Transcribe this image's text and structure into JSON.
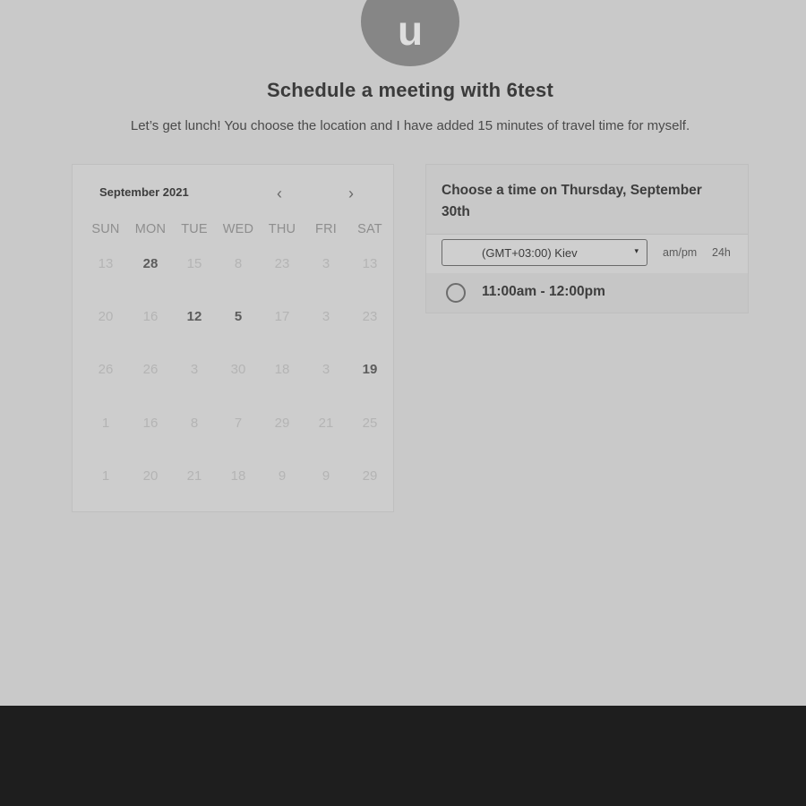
{
  "avatar": {
    "initial": "u"
  },
  "header": {
    "title": "Schedule a meeting with 6test",
    "subtitle": "Let’s get lunch! You choose the location and I have added 15 minutes of travel time for myself."
  },
  "calendar": {
    "month_label": "September 2021",
    "prev_icon": "‹",
    "next_icon": "›",
    "weekdays": [
      "SUN",
      "MON",
      "TUE",
      "WED",
      "THU",
      "FRI",
      "SAT"
    ],
    "weeks": [
      [
        {
          "d": "13",
          "bold": false
        },
        {
          "d": "28",
          "bold": true
        },
        {
          "d": "15",
          "bold": false
        },
        {
          "d": "8",
          "bold": false
        },
        {
          "d": "23",
          "bold": false
        },
        {
          "d": "3",
          "bold": false
        },
        {
          "d": "13",
          "bold": false
        }
      ],
      [
        {
          "d": "20",
          "bold": false
        },
        {
          "d": "16",
          "bold": false
        },
        {
          "d": "12",
          "bold": true
        },
        {
          "d": "5",
          "bold": true
        },
        {
          "d": "17",
          "bold": false
        },
        {
          "d": "3",
          "bold": false
        },
        {
          "d": "23",
          "bold": false
        }
      ],
      [
        {
          "d": "26",
          "bold": false
        },
        {
          "d": "26",
          "bold": false
        },
        {
          "d": "3",
          "bold": false
        },
        {
          "d": "30",
          "bold": false
        },
        {
          "d": "18",
          "bold": false
        },
        {
          "d": "3",
          "bold": false
        },
        {
          "d": "19",
          "bold": true
        }
      ],
      [
        {
          "d": "1",
          "bold": false
        },
        {
          "d": "16",
          "bold": false
        },
        {
          "d": "8",
          "bold": false
        },
        {
          "d": "7",
          "bold": false
        },
        {
          "d": "29",
          "bold": false
        },
        {
          "d": "21",
          "bold": false
        },
        {
          "d": "25",
          "bold": false
        }
      ],
      [
        {
          "d": "1",
          "bold": false
        },
        {
          "d": "20",
          "bold": false
        },
        {
          "d": "21",
          "bold": false
        },
        {
          "d": "18",
          "bold": false
        },
        {
          "d": "9",
          "bold": false
        },
        {
          "d": "9",
          "bold": false
        },
        {
          "d": "29",
          "bold": false
        }
      ]
    ]
  },
  "time_panel": {
    "title": "Choose a time on Thursday, September 30th",
    "timezone": "(GMT+03:00) Kiev",
    "caret_icon": "▾",
    "format_ampm": "am/pm",
    "format_24": "24h",
    "slots": [
      {
        "label": "11:00am - 12:00pm"
      }
    ]
  }
}
